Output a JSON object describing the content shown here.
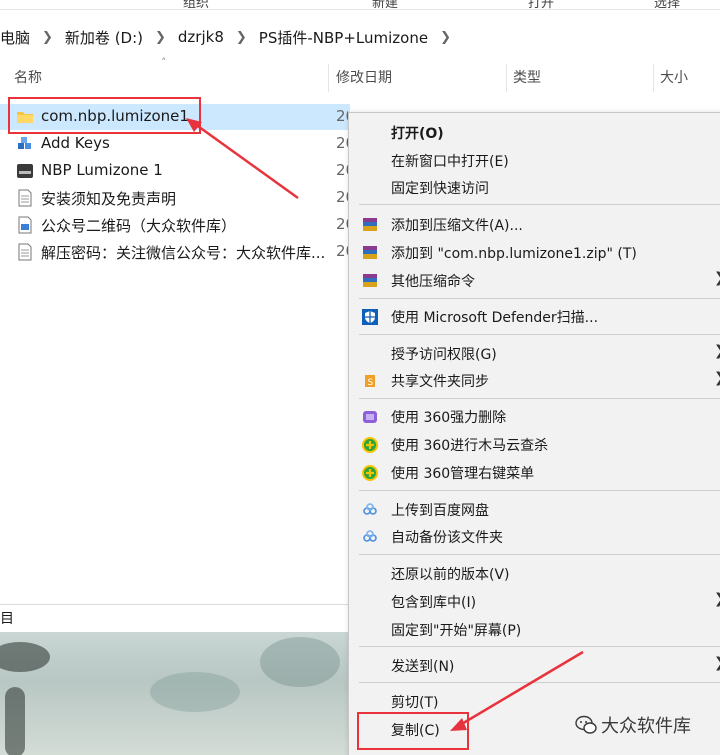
{
  "ribbon": {
    "items": [
      "组织",
      "新建",
      "打开",
      "选择"
    ]
  },
  "breadcrumb": [
    "电脑",
    "新加卷 (D:)",
    "dzrjk8",
    "PS插件-NBP+Lumizone"
  ],
  "columns": {
    "name": "名称",
    "date": "修改日期",
    "type": "类型",
    "size": "大小"
  },
  "files": [
    {
      "name": "com.nbp.lumizone1",
      "date": "20",
      "icon": "folder-icon",
      "selected": true
    },
    {
      "name": "Add Keys",
      "date": "20",
      "icon": "registry-icon"
    },
    {
      "name": "NBP Lumizone 1",
      "date": "20",
      "icon": "application-icon"
    },
    {
      "name": "安装须知及免责声明",
      "date": "20",
      "icon": "text-file-icon"
    },
    {
      "name": "公众号二维码（大众软件库）",
      "date": "20",
      "icon": "image-file-icon"
    },
    {
      "name": "解压密码：关注微信公众号：大众软件库...",
      "date": "20",
      "icon": "text-file-icon"
    }
  ],
  "statusbar": {
    "text": "目"
  },
  "context_menu": {
    "items": [
      {
        "label": "打开(O)",
        "bold": true
      },
      {
        "label": "在新窗口中打开(E)"
      },
      {
        "label": "固定到快速访问"
      },
      {
        "label": "添加到压缩文件(A)...",
        "icon": "winrar-icon"
      },
      {
        "label": "添加到 \"com.nbp.lumizone1.zip\" (T)",
        "icon": "winrar-icon"
      },
      {
        "label": "其他压缩命令",
        "icon": "winrar-icon",
        "submenu": true
      },
      {
        "label": "使用 Microsoft Defender扫描...",
        "icon": "defender-shield-icon"
      },
      {
        "label": "授予访问权限(G)",
        "submenu": true
      },
      {
        "label": "共享文件夹同步",
        "icon": "sync-folder-icon",
        "submenu": true
      },
      {
        "label": "使用 360强力删除",
        "icon": "360-delete-icon"
      },
      {
        "label": "使用 360进行木马云查杀",
        "icon": "360-scan-icon"
      },
      {
        "label": "使用 360管理右键菜单",
        "icon": "360-manage-icon"
      },
      {
        "label": "上传到百度网盘",
        "icon": "baidu-cloud-icon"
      },
      {
        "label": "自动备份该文件夹",
        "icon": "baidu-cloud-icon"
      },
      {
        "label": "还原以前的版本(V)"
      },
      {
        "label": "包含到库中(I)",
        "submenu": true
      },
      {
        "label": "固定到\"开始\"屏幕(P)"
      },
      {
        "label": "发送到(N)",
        "submenu": true
      },
      {
        "label": "剪切(T)"
      },
      {
        "label": "复制(C)"
      }
    ]
  },
  "watermark": {
    "text": "大众软件库"
  },
  "colors": {
    "selection": "#cce8ff",
    "annotation": "#e8323c",
    "menu_bg": "#f2f2f2"
  }
}
